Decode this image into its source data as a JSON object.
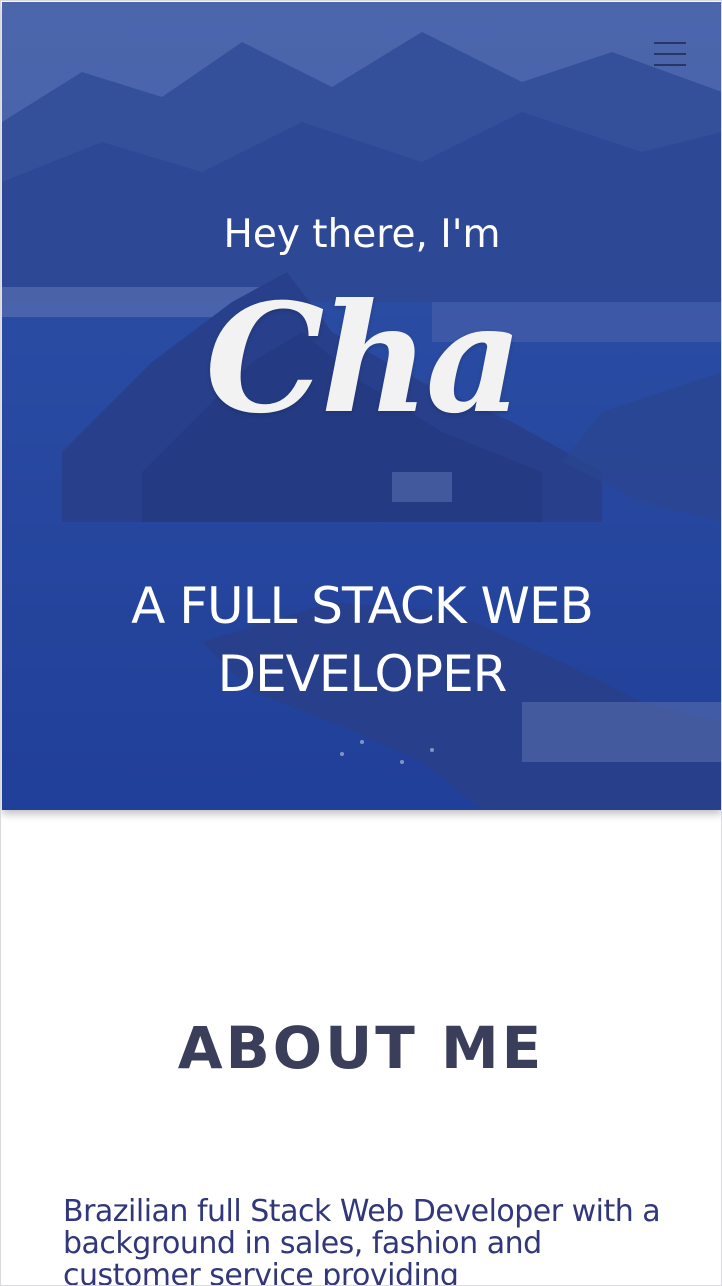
{
  "hero": {
    "greeting": "Hey there, I'm",
    "name": "Cha",
    "role": "A FULL STACK WEB DEVELOPER",
    "overlay_color": "#26409e",
    "menu_icon": "hamburger-menu-icon"
  },
  "about": {
    "title": "ABOUT ME",
    "text": "Brazilian full Stack Web Developer with a background in sales, fashion and customer service providing"
  }
}
